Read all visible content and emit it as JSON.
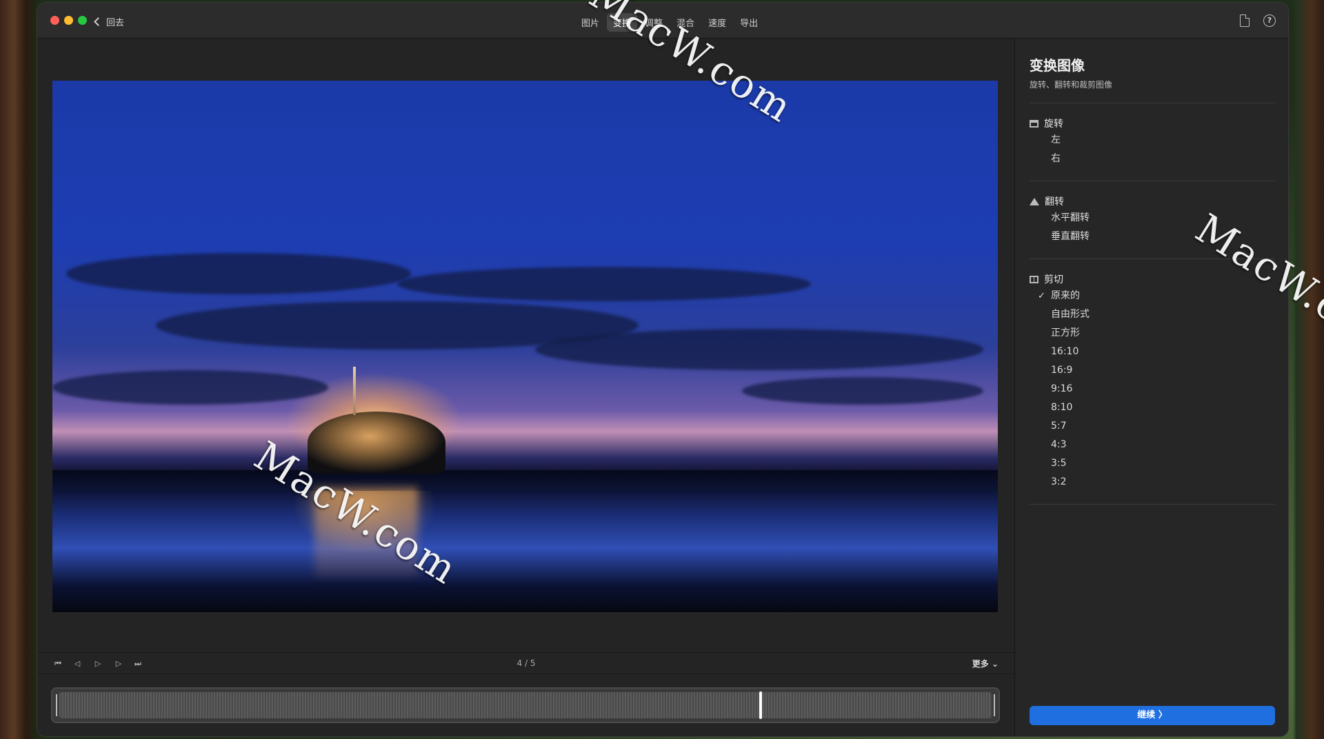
{
  "titlebar": {
    "back_label": "回去",
    "tabs": [
      {
        "label": "图片"
      },
      {
        "label": "变换"
      },
      {
        "label": "调整"
      },
      {
        "label": "混合"
      },
      {
        "label": "速度"
      },
      {
        "label": "导出"
      }
    ],
    "active_tab": "变换"
  },
  "preview": {
    "counter": "4 / 5",
    "more_label": "更多 ⌄",
    "playhead_position_fraction": 0.6
  },
  "sidebar": {
    "title": "变换图像",
    "subtitle": "旋转、翻转和裁剪图像",
    "rotate": {
      "heading": "旋转",
      "options": [
        {
          "label": "左"
        },
        {
          "label": "右"
        }
      ]
    },
    "flip": {
      "heading": "翻转",
      "options": [
        {
          "label": "水平翻转"
        },
        {
          "label": "垂直翻转"
        }
      ]
    },
    "crop": {
      "heading": "剪切",
      "selected": "原来的",
      "check_mark": "✓",
      "options": [
        {
          "label": "原来的"
        },
        {
          "label": "自由形式"
        },
        {
          "label": "正方形"
        },
        {
          "label": "16:10"
        },
        {
          "label": "16:9"
        },
        {
          "label": "9:16"
        },
        {
          "label": "8:10"
        },
        {
          "label": "5:7"
        },
        {
          "label": "4:3"
        },
        {
          "label": "3:5"
        },
        {
          "label": "3:2"
        }
      ]
    },
    "continue_label": "继续 〉"
  },
  "watermark_text": "MacW.com",
  "colors": {
    "accent": "#1f6fe0",
    "window_bg": "#232323",
    "sidebar_bg": "#262626"
  }
}
